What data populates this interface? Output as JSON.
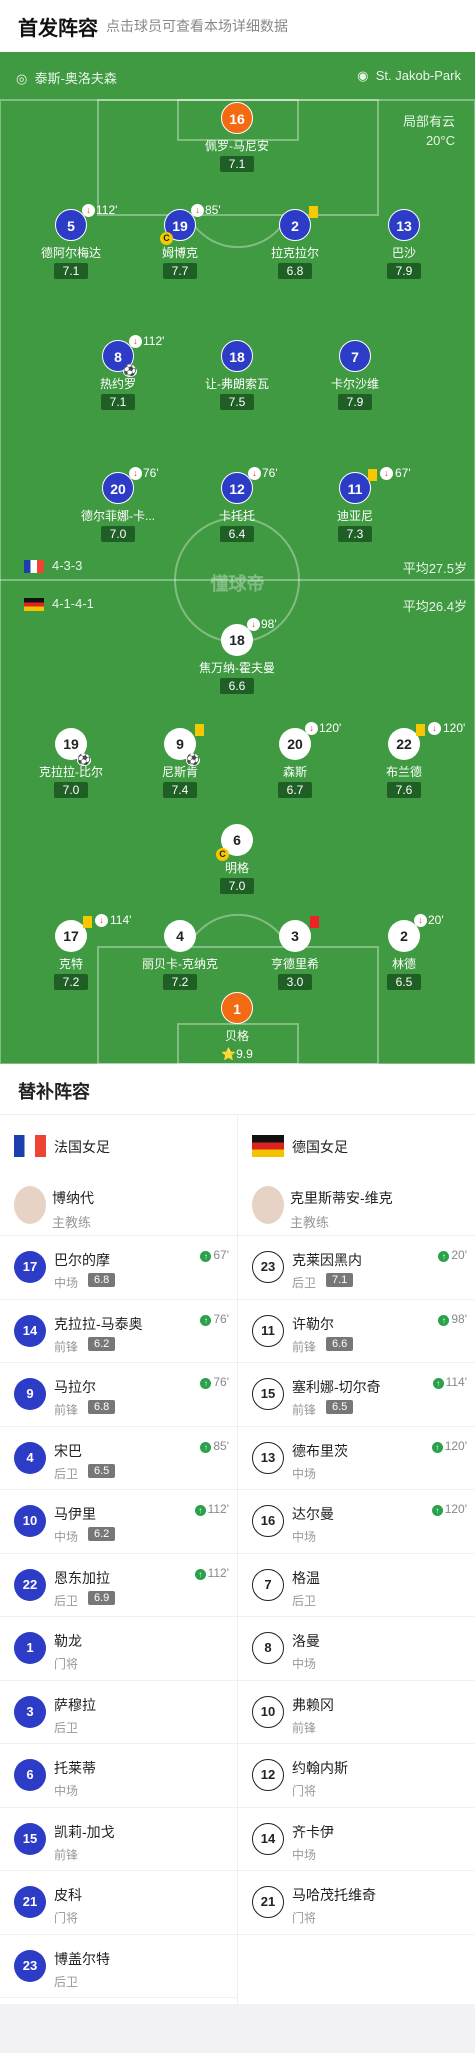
{
  "header": {
    "title": "首发阵容",
    "subtitle": "点击球员可查看本场详细数据"
  },
  "pitch": {
    "referee": "泰斯-奥洛夫森",
    "stadium": "St. Jakob-Park",
    "weather": "局部有云",
    "temperature": "20°C",
    "watermark": "懂球帝",
    "home_formation": "4-3-3",
    "home_avg_age": "平均27.5岁",
    "away_formation": "4-1-4-1",
    "away_avg_age": "平均26.4岁"
  },
  "home_players": [
    {
      "num": "16",
      "name": "佩罗-马尼安",
      "rating": "7.1"
    },
    {
      "num": "5",
      "name": "德阿尔梅达",
      "rating": "7.1",
      "sub": "112'"
    },
    {
      "num": "19",
      "name": "姆博克",
      "rating": "7.7",
      "sub": "85'"
    },
    {
      "num": "2",
      "name": "拉克拉尔",
      "rating": "6.8"
    },
    {
      "num": "13",
      "name": "巴沙",
      "rating": "7.9"
    },
    {
      "num": "8",
      "name": "热约罗",
      "rating": "7.1",
      "sub": "112'"
    },
    {
      "num": "18",
      "name": "让-弗朗索瓦",
      "rating": "7.5"
    },
    {
      "num": "7",
      "name": "卡尔沙维",
      "rating": "7.9"
    },
    {
      "num": "20",
      "name": "德尔菲娜-卡...",
      "rating": "7.0",
      "sub": "76'"
    },
    {
      "num": "12",
      "name": "卡托托",
      "rating": "6.4",
      "sub": "76'"
    },
    {
      "num": "11",
      "name": "迪亚尼",
      "rating": "7.3",
      "sub": "67'"
    }
  ],
  "away_players": [
    {
      "num": "18",
      "name": "焦万纳-霍夫曼",
      "rating": "6.6",
      "sub": "98'"
    },
    {
      "num": "19",
      "name": "克拉拉-比尔",
      "rating": "7.0"
    },
    {
      "num": "9",
      "name": "尼斯肯",
      "rating": "7.4"
    },
    {
      "num": "20",
      "name": "森斯",
      "rating": "6.7",
      "sub": "120'"
    },
    {
      "num": "22",
      "name": "布兰德",
      "rating": "7.6",
      "sub": "120'"
    },
    {
      "num": "6",
      "name": "明格",
      "rating": "7.0"
    },
    {
      "num": "17",
      "name": "克特",
      "rating": "7.2",
      "sub": "114'"
    },
    {
      "num": "4",
      "name": "丽贝卡-克纳克",
      "rating": "7.2"
    },
    {
      "num": "3",
      "name": "亨德里希",
      "rating": "3.0"
    },
    {
      "num": "2",
      "name": "林德",
      "rating": "6.5",
      "sub": "20'"
    },
    {
      "num": "1",
      "name": "贝格",
      "rating": "⭐9.9"
    }
  ],
  "bench": {
    "title": "替补阵容",
    "home_team": "法国女足",
    "away_team": "德国女足",
    "home_coach": {
      "name": "博纳代",
      "role": "主教练"
    },
    "away_coach": {
      "name": "克里斯蒂安-维克",
      "role": "主教练"
    },
    "home_subs": [
      {
        "num": "17",
        "name": "巴尔的摩",
        "pos": "中场",
        "rating": "6.8",
        "min": "67'"
      },
      {
        "num": "14",
        "name": "克拉拉-马泰奥",
        "pos": "前锋",
        "rating": "6.2",
        "min": "76'"
      },
      {
        "num": "9",
        "name": "马拉尔",
        "pos": "前锋",
        "rating": "6.8",
        "min": "76'"
      },
      {
        "num": "4",
        "name": "宋巴",
        "pos": "后卫",
        "rating": "6.5",
        "min": "85'"
      },
      {
        "num": "10",
        "name": "马伊里",
        "pos": "中场",
        "rating": "6.2",
        "min": "112'"
      },
      {
        "num": "22",
        "name": "恩东加拉",
        "pos": "后卫",
        "rating": "6.9",
        "min": "112'"
      },
      {
        "num": "1",
        "name": "勒龙",
        "pos": "门将",
        "rating": "",
        "min": ""
      },
      {
        "num": "3",
        "name": "萨穆拉",
        "pos": "后卫",
        "rating": "",
        "min": ""
      },
      {
        "num": "6",
        "name": "托莱蒂",
        "pos": "中场",
        "rating": "",
        "min": ""
      },
      {
        "num": "15",
        "name": "凯莉-加戈",
        "pos": "前锋",
        "rating": "",
        "min": ""
      },
      {
        "num": "21",
        "name": "皮科",
        "pos": "门将",
        "rating": "",
        "min": ""
      },
      {
        "num": "23",
        "name": "博盖尔特",
        "pos": "后卫",
        "rating": "",
        "min": ""
      }
    ],
    "away_subs": [
      {
        "num": "23",
        "name": "克莱因黑内",
        "pos": "后卫",
        "rating": "7.1",
        "min": "20'"
      },
      {
        "num": "11",
        "name": "许勒尔",
        "pos": "前锋",
        "rating": "6.6",
        "min": "98'"
      },
      {
        "num": "15",
        "name": "塞利娜-切尔奇",
        "pos": "前锋",
        "rating": "6.5",
        "min": "114'"
      },
      {
        "num": "13",
        "name": "德布里茨",
        "pos": "中场",
        "rating": "",
        "min": "120'"
      },
      {
        "num": "16",
        "name": "达尔曼",
        "pos": "中场",
        "rating": "",
        "min": "120'"
      },
      {
        "num": "7",
        "name": "格温",
        "pos": "后卫",
        "rating": "",
        "min": ""
      },
      {
        "num": "8",
        "name": "洛曼",
        "pos": "中场",
        "rating": "",
        "min": ""
      },
      {
        "num": "10",
        "name": "弗赖冈",
        "pos": "前锋",
        "rating": "",
        "min": ""
      },
      {
        "num": "12",
        "name": "约翰内斯",
        "pos": "门将",
        "rating": "",
        "min": ""
      },
      {
        "num": "14",
        "name": "齐卡伊",
        "pos": "中场",
        "rating": "",
        "min": ""
      },
      {
        "num": "21",
        "name": "马哈茂托维奇",
        "pos": "门将",
        "rating": "",
        "min": ""
      }
    ]
  }
}
